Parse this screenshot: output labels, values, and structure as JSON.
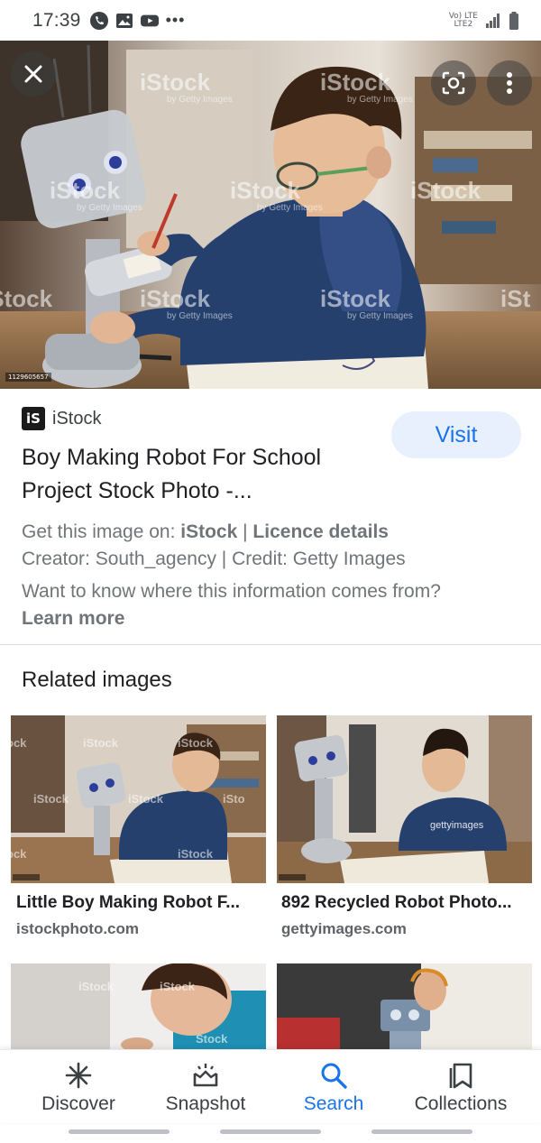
{
  "status_bar": {
    "time": "17:39",
    "icons": [
      "phone-icon",
      "gallery-icon",
      "youtube-icon",
      "more-dots"
    ],
    "network_top": "Vo) LTE",
    "network_bottom": "LTE2"
  },
  "hero": {
    "image_id": "1129605657",
    "watermark": "iStock",
    "watermark_sub": "by Getty Images"
  },
  "result": {
    "source_name": "iStock",
    "source_logo": "iS",
    "visit_label": "Visit",
    "title_line1": "Boy Making Robot For School",
    "title_line2": "Project Stock Photo -...",
    "get_image_prefix": "Get this image on: ",
    "get_image_site": "iStock",
    "separator": " | ",
    "licence": "Licence details",
    "creator": "Creator: South_agency | Credit: Getty Images",
    "info_text": "Want to know where this information comes from? ",
    "learn_more": "Learn more"
  },
  "related": {
    "heading": "Related images",
    "items": [
      {
        "title": "Little Boy Making Robot F...",
        "domain": "istockphoto.com"
      },
      {
        "title": "892 Recycled Robot Photo...",
        "domain": "gettyimages.com"
      }
    ]
  },
  "bottom_nav": {
    "items": [
      {
        "label": "Discover",
        "icon": "asterisk-icon"
      },
      {
        "label": "Snapshot",
        "icon": "snapshot-icon"
      },
      {
        "label": "Search",
        "icon": "search-icon",
        "active": true
      },
      {
        "label": "Collections",
        "icon": "bookmark-icon"
      }
    ]
  },
  "colors": {
    "accent": "#1a73e8",
    "visit_bg": "#e8f0fe",
    "text_primary": "#202124",
    "text_secondary": "#70757a"
  }
}
